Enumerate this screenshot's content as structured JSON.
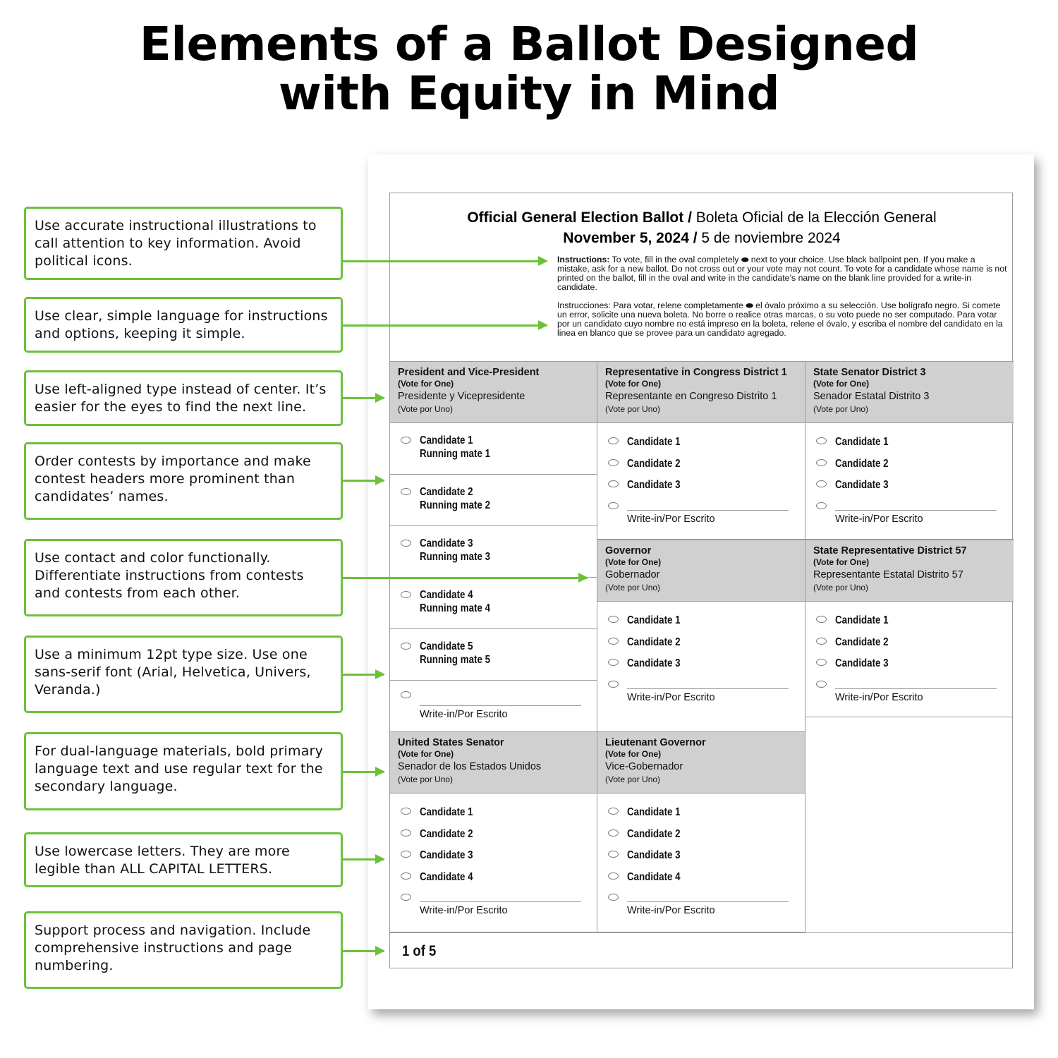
{
  "title": {
    "line1": "Elements of a Ballot Designed",
    "line2": "with Equity in Mind"
  },
  "colors": {
    "accent": "#6cc13a",
    "header_bg": "#d0d0d0",
    "border": "#9a9a9a"
  },
  "callouts": [
    {
      "text": "Use accurate instructional illustrations to call attention to key information. Avoid political icons."
    },
    {
      "text": "Use clear, simple language for instructions and options, keeping it simple."
    },
    {
      "text": "Use left-aligned type instead of center. It’s easier for the eyes to find the next line."
    },
    {
      "text": "Order contests by importance and make contest headers more prominent than candidates’ names."
    },
    {
      "text": "Use contact and color functionally. Differentiate instructions from contests and contests from each other."
    },
    {
      "text": "Use a minimum 12pt type size. Use one sans-serif font (Arial, Helvetica, Univers, Veranda.)"
    },
    {
      "text": "For dual-language materials, bold primary language text and use regular text for the secondary language."
    },
    {
      "text": "Use lowercase letters. They are more legible than ALL CAPITAL LETTERS."
    },
    {
      "text": "Support process and navigation. Include comprehensive instructions and page numbering."
    }
  ],
  "ballot": {
    "title_en": "Official General Election Ballot",
    "title_sep": " / ",
    "title_es": "Boleta Oficial de la Elección General",
    "date_en": "November 5, 2024",
    "date_es": "5 de noviembre 2024",
    "instructions_en_label": "Instructions:",
    "instructions_en": " To vote, fill in the oval completely ⬬ next to your choice. Use black ballpoint pen. If you make a mistake, ask for a new ballot. Do not cross out or your vote may not count. To vote for a candidate whose name is not printed on the ballot, fill in the oval and write in the candidate’s name on the blank line provided for a write-in candidate.",
    "instructions_es": "Instrucciones: Para votar, relene completamente ⬬ el óvalo próximo a su selección. Use bolígrafo negro. Si comete un error, solicite una nueva boleta. No borre o realice otras marcas, o su voto puede no ser computado. Para votar por un candidato cuyo nombre no está impreso en la boleta, relene el óvalo, y escriba el nombre del candidato en la linea en blanco que se provee para un candidato agregado.",
    "vote_for_one": "(Vote for One)",
    "vote_por_uno": "(Vote por Uno)",
    "write_in_label": "Write-in/Por Escrito",
    "contests": {
      "president": {
        "en": "President and Vice-President",
        "es": "Presidente y Vicepresidente",
        "options": [
          {
            "candidate": "Candidate 1",
            "mate": "Running mate 1"
          },
          {
            "candidate": "Candidate 2",
            "mate": "Running mate 2"
          },
          {
            "candidate": "Candidate 3",
            "mate": "Running mate 3"
          },
          {
            "candidate": "Candidate 4",
            "mate": "Running mate 4"
          },
          {
            "candidate": "Candidate 5",
            "mate": "Running mate 5"
          }
        ]
      },
      "congress": {
        "en": "Representative in Congress District 1",
        "es": "Representante en Congreso Distrito 1",
        "options": [
          "Candidate 1",
          "Candidate 2",
          "Candidate 3"
        ]
      },
      "state_senator": {
        "en": "State Senator District 3",
        "es": "Senador Estatal Distrito 3",
        "options": [
          "Candidate 1",
          "Candidate 2",
          "Candidate 3"
        ]
      },
      "governor": {
        "en": "Governor",
        "es": "Gobernador",
        "options": [
          "Candidate 1",
          "Candidate 2",
          "Candidate 3"
        ]
      },
      "state_rep": {
        "en": "State Representative District 57",
        "es": "Representante Estatal Distrito 57",
        "options": [
          "Candidate 1",
          "Candidate 2",
          "Candidate 3"
        ]
      },
      "us_senator": {
        "en": "United States Senator",
        "es": "Senador de los Estados Unidos",
        "options": [
          "Candidate 1",
          "Candidate 2",
          "Candidate 3",
          "Candidate 4"
        ]
      },
      "lt_governor": {
        "en": "Lieutenant Governor",
        "es": "Vice-Gobernador",
        "options": [
          "Candidate 1",
          "Candidate 2",
          "Candidate 3",
          "Candidate 4"
        ]
      }
    },
    "page_number": "1 of 5"
  }
}
